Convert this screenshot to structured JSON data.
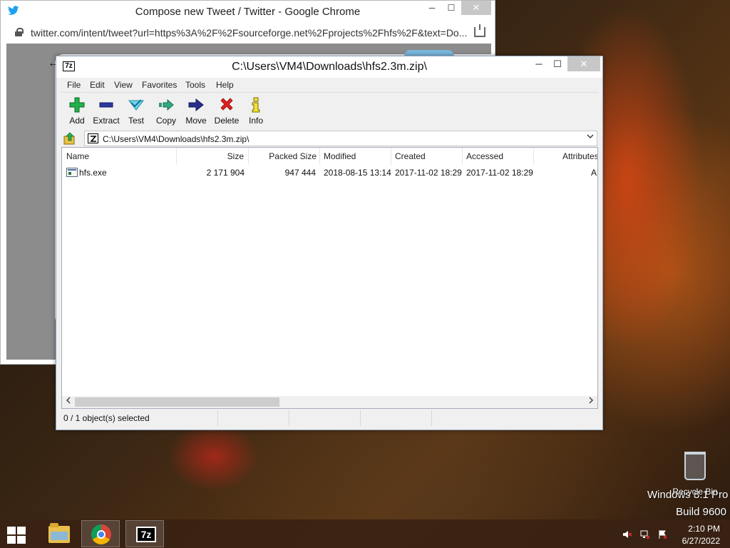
{
  "chrome": {
    "title": "Compose new Tweet / Twitter - Google Chrome",
    "url": "twitter.com/intent/tweet?url=https%3A%2F%2Fsourceforge.net%2Fprojects%2Fhfs%2F&text=Do...",
    "minimize": "─",
    "maximize": "☐",
    "close": "✕",
    "back": "←"
  },
  "sevenzip": {
    "title": "C:\\Users\\VM4\\Downloads\\hfs2.3m.zip\\",
    "minimize": "─",
    "maximize": "☐",
    "close": "✕",
    "menu": [
      "File",
      "Edit",
      "View",
      "Favorites",
      "Tools",
      "Help"
    ],
    "toolbar": [
      "Add",
      "Extract",
      "Test",
      "Copy",
      "Move",
      "Delete",
      "Info"
    ],
    "address": "C:\\Users\\VM4\\Downloads\\hfs2.3m.zip\\",
    "columns": [
      "Name",
      "Size",
      "Packed Size",
      "Modified",
      "Created",
      "Accessed",
      "Attributes"
    ],
    "rows": [
      {
        "name": "hfs.exe",
        "size": "2 171 904",
        "packed_size": "947 444",
        "modified": "2018-08-15 13:14",
        "created": "2017-11-02 18:29",
        "accessed": "2017-11-02 18:29",
        "attributes": "A"
      }
    ],
    "status": "0 / 1 object(s) selected"
  },
  "desktop": {
    "recycle_bin": "Recycle Bin",
    "watermark_edition": "Windows 8.1 Pro",
    "watermark_build": "Build 9600"
  },
  "taskbar": {
    "sevenzip_label": "7z",
    "time": "2:10 PM",
    "date": "6/27/2022"
  }
}
